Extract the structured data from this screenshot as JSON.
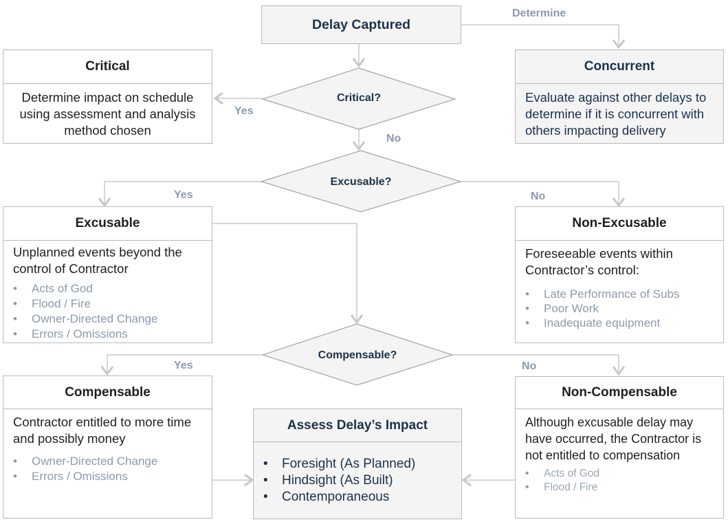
{
  "nodes": {
    "delay_captured": {
      "title": "Delay Captured"
    },
    "critical": {
      "title": "Critical",
      "body": "Determine impact on schedule using assessment and analysis method chosen"
    },
    "concurrent": {
      "title": "Concurrent",
      "body": "Evaluate against other delays to determine if it is concurrent with others impacting delivery"
    },
    "excusable": {
      "title": "Excusable",
      "body": "Unplanned events beyond the control of Contractor",
      "items": [
        "Acts of God",
        "Flood / Fire",
        "Owner-Directed Change",
        "Errors / Omissions"
      ]
    },
    "non_excusable": {
      "title": "Non-Excusable",
      "body": "Foreseeable events within Contractor’s control:",
      "items": [
        "Late Performance of Subs",
        "Poor Work",
        "Inadequate equipment"
      ]
    },
    "compensable": {
      "title": "Compensable",
      "body": "Contractor entitled to more time and possibly money",
      "items": [
        "Owner-Directed Change",
        "Errors / Omissions"
      ]
    },
    "non_compensable": {
      "title": "Non-Compensable",
      "body": "Although excusable delay may have occurred, the Contractor is not entitled to compensation",
      "items": [
        "Acts of God",
        "Flood / Fire"
      ]
    },
    "assess": {
      "title": "Assess Delay’s Impact",
      "items": [
        "Foresight (As Planned)",
        "Hindsight (As Built)",
        "Contemporaneous"
      ]
    }
  },
  "decisions": {
    "critical_q": "Critical?",
    "excusable_q": "Excusable?",
    "compensable_q": "Compensable?"
  },
  "edge_labels": {
    "determine": "Determine",
    "critical_yes": "Yes",
    "critical_no": "No",
    "excusable_yes": "Yes",
    "excusable_no": "No",
    "compensable_yes": "Yes",
    "compensable_no": "No"
  },
  "colors": {
    "navy_text": "#1e3148",
    "label_gray": "#8c9aab",
    "border": "#b9b9b9",
    "shade": "#f4f4f4"
  }
}
